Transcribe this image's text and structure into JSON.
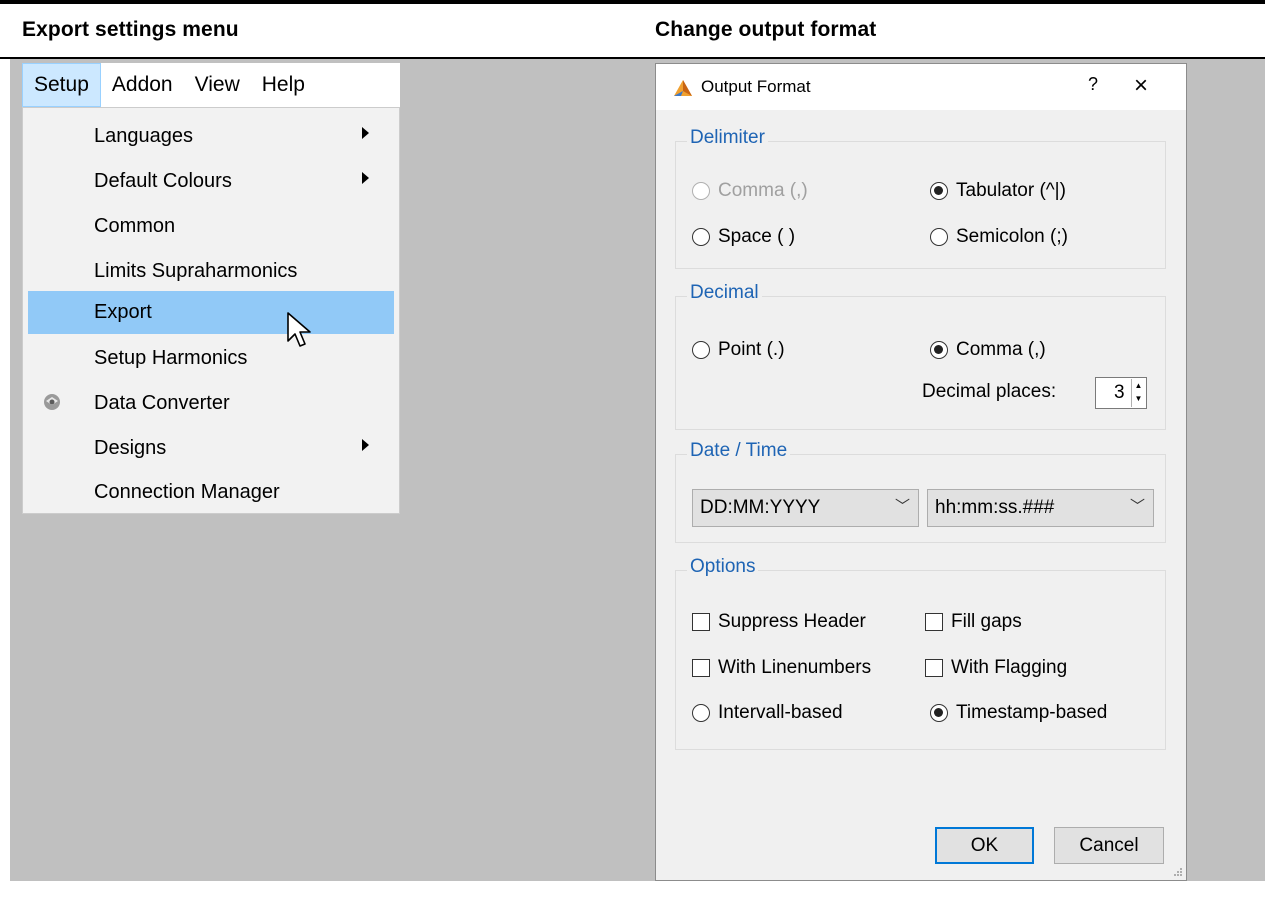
{
  "headings": {
    "left": "Export settings menu",
    "right": "Change output format"
  },
  "menubar": {
    "items": [
      "Setup",
      "Addon",
      "View",
      "Help"
    ],
    "active": "Setup"
  },
  "dropdown": {
    "items": [
      {
        "label": "Languages",
        "submenu": true
      },
      {
        "label": "Default Colours",
        "submenu": true
      },
      {
        "label": "Common",
        "submenu": false
      },
      {
        "label": "Limits Supraharmonics",
        "submenu": false
      },
      {
        "label": "Export",
        "submenu": false,
        "highlighted": true
      },
      {
        "label": "Setup Harmonics",
        "submenu": false
      },
      {
        "label": "Data Converter",
        "submenu": false,
        "icon": "data-converter-icon"
      },
      {
        "label": "Designs",
        "submenu": true
      },
      {
        "label": "Connection Manager",
        "submenu": false
      }
    ]
  },
  "dialog": {
    "title": "Output Format",
    "help": "?",
    "close": "×",
    "delimiter": {
      "title": "Delimiter",
      "comma": "Comma (,)",
      "tab": "Tabulator (^|)",
      "space": "Space ( )",
      "semicolon": "Semicolon (;)",
      "selected": "Tabulator (^|)"
    },
    "decimal": {
      "title": "Decimal",
      "point": "Point (.)",
      "comma": "Comma (,)",
      "selected": "Comma (,)",
      "places_label": "Decimal places:",
      "places_value": "3"
    },
    "datetime": {
      "title": "Date / Time",
      "date_format": "DD:MM:YYYY",
      "time_format": "hh:mm:ss.###"
    },
    "options": {
      "title": "Options",
      "suppress_header": "Suppress Header",
      "fill_gaps": "Fill gaps",
      "with_linenumbers": "With Linenumbers",
      "with_flagging": "With Flagging",
      "intervall_based": "Intervall-based",
      "timestamp_based": "Timestamp-based",
      "selected": "Timestamp-based"
    },
    "ok": "OK",
    "cancel": "Cancel"
  },
  "colors": {
    "accent": "#0078d7",
    "menu_highlight": "#91c9f7",
    "group_title": "#1e64b4",
    "background_gray": "#c0c0c0"
  }
}
